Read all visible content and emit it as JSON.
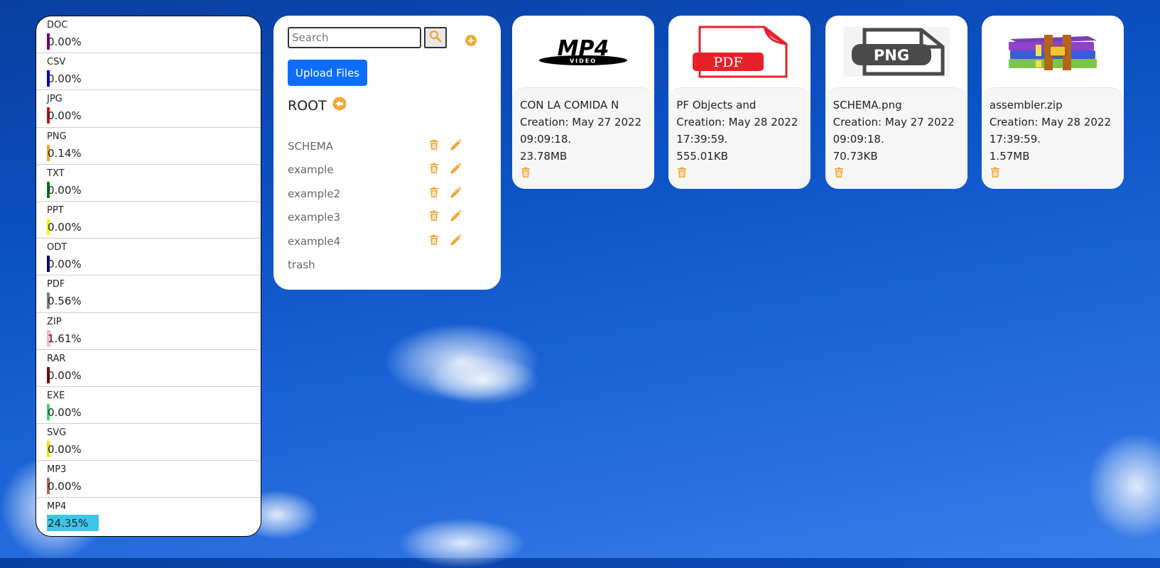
{
  "colors": {
    "accent": "#f0a93b",
    "primary_button": "#0d6efd"
  },
  "stats": {
    "items": [
      {
        "label": "DOC",
        "value": "0.00%",
        "percent": 0,
        "color": "#800080"
      },
      {
        "label": "CSV",
        "value": "0.00%",
        "percent": 0,
        "color": "#0000cc"
      },
      {
        "label": "JPG",
        "value": "0.00%",
        "percent": 0,
        "color": "#d01010"
      },
      {
        "label": "PNG",
        "value": "0.14%",
        "percent": 0.14,
        "color": "#f5a623"
      },
      {
        "label": "TXT",
        "value": "0.00%",
        "percent": 0,
        "color": "#0a7a14"
      },
      {
        "label": "PPT",
        "value": "0.00%",
        "percent": 0,
        "color": "#f4f400"
      },
      {
        "label": "ODT",
        "value": "0.00%",
        "percent": 0,
        "color": "#000080"
      },
      {
        "label": "PDF",
        "value": "0.56%",
        "percent": 0.56,
        "color": "#808080"
      },
      {
        "label": "ZIP",
        "value": "1.61%",
        "percent": 1.61,
        "color": "#f8b8c4"
      },
      {
        "label": "RAR",
        "value": "0.00%",
        "percent": 0,
        "color": "#800010"
      },
      {
        "label": "EXE",
        "value": "0.00%",
        "percent": 0,
        "color": "#33dd66"
      },
      {
        "label": "SVG",
        "value": "0.00%",
        "percent": 0,
        "color": "#f7e000"
      },
      {
        "label": "MP3",
        "value": "0.00%",
        "percent": 0,
        "color": "#b06a50"
      },
      {
        "label": "MP4",
        "value": "24.35%",
        "percent": 24.35,
        "color": "#3cc6e8"
      }
    ]
  },
  "folders": {
    "search_placeholder": "Search",
    "upload_label": "Upload Files",
    "root_label": "ROOT",
    "items": [
      {
        "name": "SCHEMA",
        "editable": true
      },
      {
        "name": "example",
        "editable": true
      },
      {
        "name": "example2",
        "editable": true
      },
      {
        "name": "example3",
        "editable": true
      },
      {
        "name": "example4",
        "editable": true
      },
      {
        "name": "trash",
        "editable": false
      }
    ]
  },
  "files": [
    {
      "name": "CON LA COMIDA N",
      "creation": "Creation: May 27 2022",
      "time": "09:09:18.",
      "size": "23.78MB",
      "thumb": "mp4",
      "thumb_text": "MP4",
      "thumb_subtext": "VIDEO"
    },
    {
      "name": "PF Objects and",
      "creation": "Creation: May 28 2022",
      "time": "17:39:59.",
      "size": "555.01KB",
      "thumb": "pdf",
      "thumb_text": "PDF",
      "thumb_subtext": ""
    },
    {
      "name": "SCHEMA.png",
      "creation": "Creation: May 27 2022",
      "time": "09:09:18.",
      "size": "70.73KB",
      "thumb": "png",
      "thumb_text": "PNG",
      "thumb_subtext": ""
    },
    {
      "name": "assembler.zip",
      "creation": "Creation: May 28 2022",
      "time": "17:39:59.",
      "size": "1.57MB",
      "thumb": "zip",
      "thumb_text": "",
      "thumb_subtext": ""
    }
  ]
}
